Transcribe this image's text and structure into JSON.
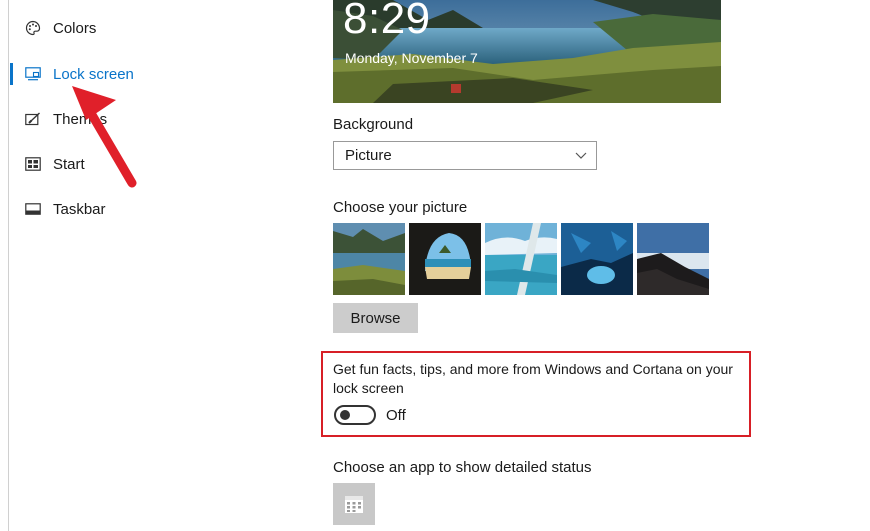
{
  "nav": {
    "items": [
      {
        "label": "Colors",
        "icon": "palette-icon"
      },
      {
        "label": "Lock screen",
        "icon": "lock-screen-icon",
        "active": true
      },
      {
        "label": "Themes",
        "icon": "themes-icon"
      },
      {
        "label": "Start",
        "icon": "start-icon"
      },
      {
        "label": "Taskbar",
        "icon": "taskbar-icon"
      }
    ]
  },
  "preview": {
    "time": "8:29",
    "date": "Monday, November 7"
  },
  "background": {
    "label": "Background",
    "selected": "Picture"
  },
  "choose_picture": {
    "label": "Choose your picture",
    "thumbnails": [
      "mountain-lake",
      "cave-beach",
      "glacier-lake",
      "ice-cave",
      "mountain-clouds"
    ]
  },
  "browse": {
    "label": "Browse"
  },
  "tips": {
    "text": "Get fun facts, tips, and more from Windows and Cortana on your lock screen",
    "toggle_state": "Off"
  },
  "detailed_status": {
    "label": "Choose an app to show detailed status",
    "app_icon": "calendar-icon"
  },
  "colors": {
    "accent": "#0a74c9",
    "highlight": "#d71f26",
    "annotation_arrow": "#e0202a"
  }
}
